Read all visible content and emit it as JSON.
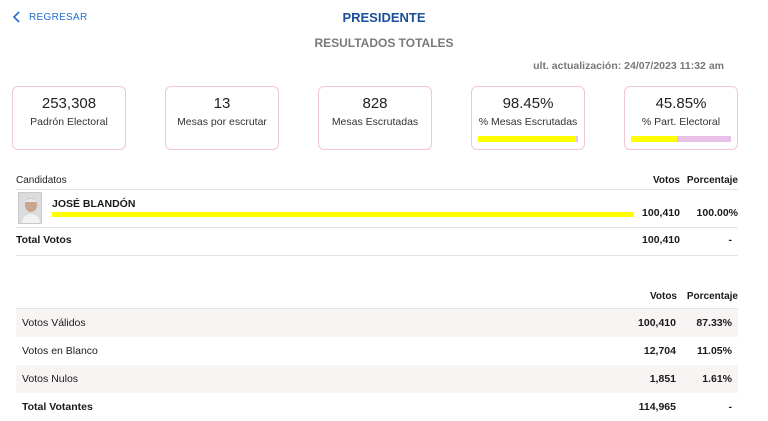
{
  "nav": {
    "back_label": "REGRESAR",
    "title": "PRESIDENTE",
    "subtitle": "RESULTADOS TOTALES"
  },
  "updated": "ult. actualización: 24/07/2023 11:32 am",
  "stats": [
    {
      "value": "253,308",
      "label": "Padrón Electoral"
    },
    {
      "value": "13",
      "label": "Mesas por escrutar"
    },
    {
      "value": "828",
      "label": "Mesas Escrutadas"
    },
    {
      "value": "98.45%",
      "label": "% Mesas Escrutadas",
      "progress": 0.9845
    },
    {
      "value": "45.85%",
      "label": "% Part. Electoral",
      "progress": 0.4585
    }
  ],
  "candidates_table": {
    "headers": {
      "candidate": "Candidatos",
      "votes": "Votos",
      "percent": "Porcentaje"
    },
    "rows": [
      {
        "name": "JOSÉ BLANDÓN",
        "votes": "100,410",
        "percent": "100.00%",
        "share": 1.0
      }
    ],
    "total": {
      "label": "Total Votos",
      "votes": "100,410",
      "percent": "-"
    }
  },
  "summary_table": {
    "headers": {
      "votes": "Votos",
      "percent": "Porcentaje"
    },
    "rows": [
      {
        "label": "Votos Válidos",
        "votes": "100,410",
        "percent": "87.33%"
      },
      {
        "label": "Votos en Blanco",
        "votes": "12,704",
        "percent": "11.05%"
      },
      {
        "label": "Votos Nulos",
        "votes": "1,851",
        "percent": "1.61%"
      },
      {
        "label": "Total Votantes",
        "votes": "114,965",
        "percent": "-"
      }
    ]
  },
  "colors": {
    "accent": "#1f6fd1",
    "title": "#1a4f9c",
    "bar": "#ffff00",
    "bar_track": "#e8c0e6",
    "card_border": "#f3c6d6"
  }
}
